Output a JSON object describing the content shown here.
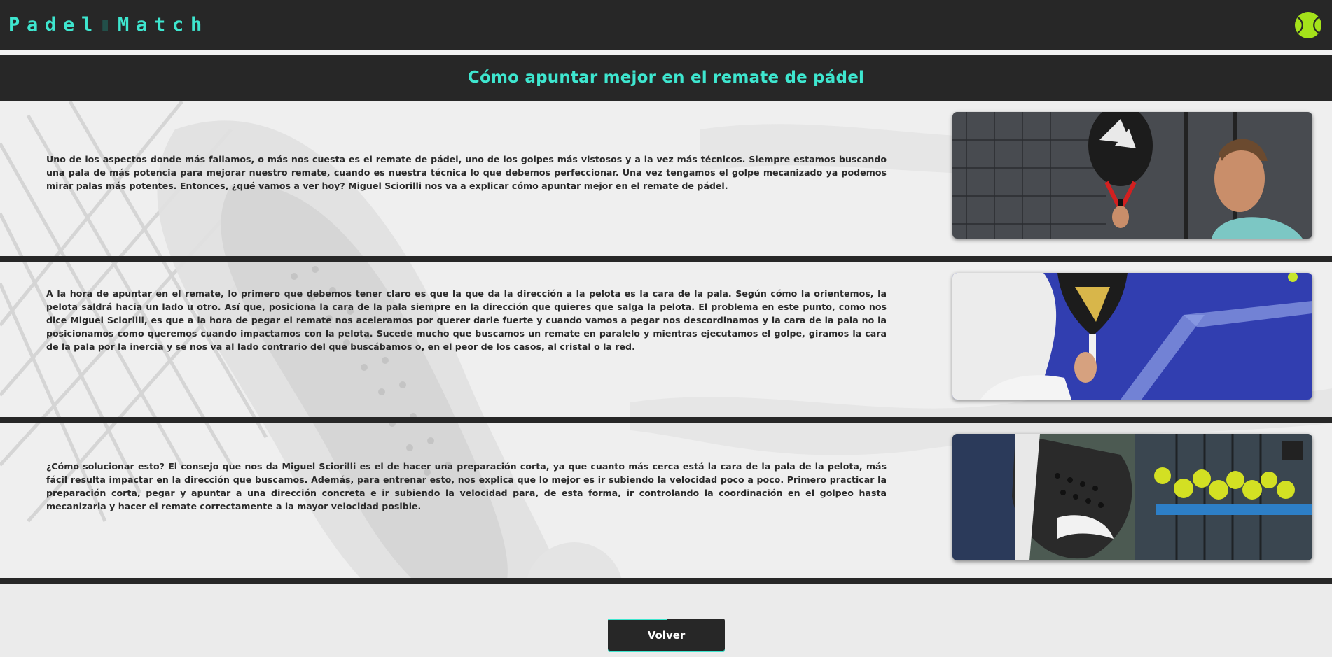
{
  "header": {
    "logo_letters": [
      "P",
      "a",
      "d",
      "e",
      "l",
      "M",
      "a",
      "t",
      "c",
      "h"
    ],
    "ball_icon": "tennis-ball-icon"
  },
  "page": {
    "title": "Cómo apuntar mejor en el remate de pádel"
  },
  "sections": [
    {
      "text": "Uno de los aspectos donde más fallamos, o más nos cuesta es el remate de pádel, uno de los golpes más vistosos y a la vez más técnicos. Siempre estamos buscando una pala de más potencia para mejorar nuestro remate, cuando es nuestra técnica lo que debemos perfeccionar. Una vez tengamos el golpe mecanizado ya podemos mirar palas más potentes. Entonces, ¿qué vamos a ver hoy? Miguel Sciorilli nos va a explicar cómo apuntar mejor en el remate de pádel.",
      "image": "player-inspecting-racket-photo"
    },
    {
      "text": "A la hora de apuntar en el remate, lo primero que debemos tener claro es que la que da la dirección a la pelota es la cara de la pala. Según cómo la orientemos, la pelota saldrá hacia un lado u otro. Así que, posiciona la cara de la pala siempre en la dirección que quieres que salga la pelota. El problema en este punto, como nos dice Miguel Sciorilli, es que a la hora de pegar el remate nos aceleramos por querer darle fuerte y cuando vamos a pegar nos descordinamos y la cara de la pala no la posicionamos como queremos cuando impactamos con la pelota. Sucede mucho que buscamos un remate en paralelo y mientras ejecutamos el golpe, giramos la cara de la pala por la inercia y se nos va al lado contrario del que buscábamos o, en el peor de los casos, al cristal o la red.",
      "image": "player-holding-racket-court-photo"
    },
    {
      "text": "¿Cómo solucionar esto? El consejo que nos da Miguel Sciorilli es el de hacer una preparación corta, ya que cuanto más cerca está la cara de la pala de la pelota, más fácil resulta impactar en la dirección que buscamos. Además, para entrenar esto, nos explica que lo mejor es ir subiendo la velocidad poco a poco. Primero practicar la preparación corta, pegar y apuntar a una dirección concreta e ir subiendo la velocidad para, de esta forma, ir controlando la coordinación en el golpeo hasta mecanizarla y hacer el remate correctamente a la mayor velocidad posible.",
      "image": "racket-and-balls-photo"
    }
  ],
  "footer": {
    "back_label": "Volver"
  },
  "colors": {
    "accent": "#3ee6cf",
    "bar": "#272727",
    "ball": "#a4e21a"
  }
}
